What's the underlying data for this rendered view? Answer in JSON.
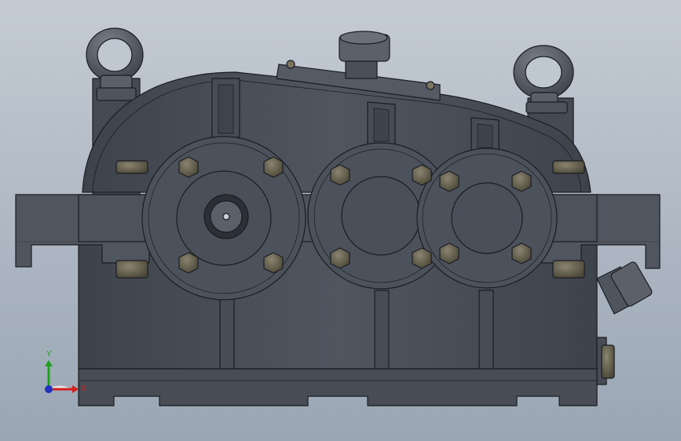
{
  "viewport": {
    "background_top": "#c4cbd4",
    "background_bottom": "#9aa6b4",
    "body_color": "#4a505a",
    "edge_color": "#1a1d22",
    "bolt_color": "#6b6550"
  },
  "triad": {
    "x_label": "X",
    "y_label": "Y",
    "x_color": "#d42020",
    "y_color": "#20a020",
    "z_color": "#2030c0"
  }
}
